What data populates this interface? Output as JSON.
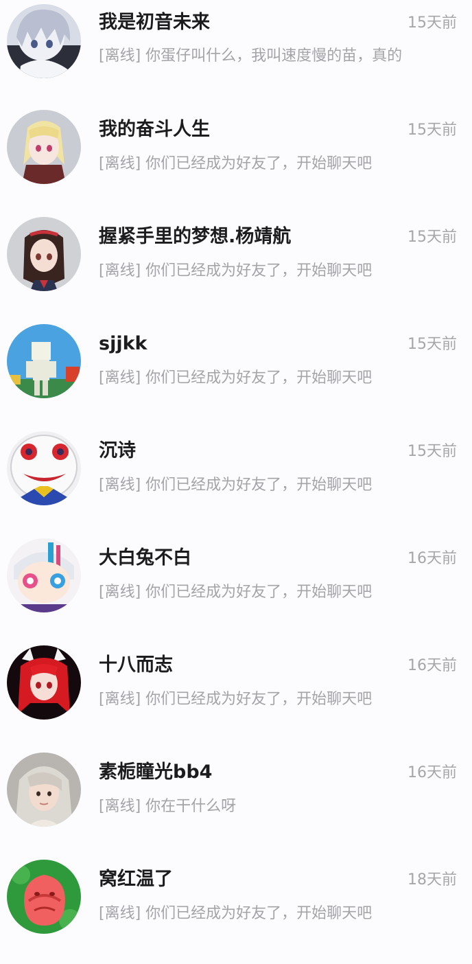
{
  "conversations": [
    {
      "name": "我是初音未来",
      "time": "15天前",
      "status": "[离线]",
      "message": "你蛋仔叫什么，我叫速度慢的苗，真的",
      "avatar": "avatar-silver-hair-anime"
    },
    {
      "name": "我的奋斗人生",
      "time": "15天前",
      "status": "[离线]",
      "message": "你们已经成为好友了，开始聊天吧",
      "avatar": "avatar-blonde-anime"
    },
    {
      "name": "握紧手里的梦想.杨靖航",
      "time": "15天前",
      "status": "[离线]",
      "message": "你们已经成为好友了，开始聊天吧",
      "avatar": "avatar-brown-hair-anime"
    },
    {
      "name": "sjjkk",
      "time": "15天前",
      "status": "[离线]",
      "message": "你们已经成为好友了，开始聊天吧",
      "avatar": "avatar-blocky-game"
    },
    {
      "name": "沉诗",
      "time": "15天前",
      "status": "[离线]",
      "message": "你们已经成为好友了，开始聊天吧",
      "avatar": "avatar-clown-face"
    },
    {
      "name": "大白兔不白",
      "time": "16天前",
      "status": "[离线]",
      "message": "你们已经成为好友了，开始聊天吧",
      "avatar": "avatar-colorful-anime"
    },
    {
      "name": "十八而志",
      "time": "16天前",
      "status": "[离线]",
      "message": "你们已经成为好友了，开始聊天吧",
      "avatar": "avatar-red-hair-anime"
    },
    {
      "name": "素栀瞳光bb4",
      "time": "16天前",
      "status": "[离线]",
      "message": "你在干什么呀",
      "avatar": "avatar-photo-girl"
    },
    {
      "name": "窝红温了",
      "time": "18天前",
      "status": "[离线]",
      "message": "你们已经成为好友了，开始聊天吧",
      "avatar": "avatar-red-creature"
    }
  ]
}
